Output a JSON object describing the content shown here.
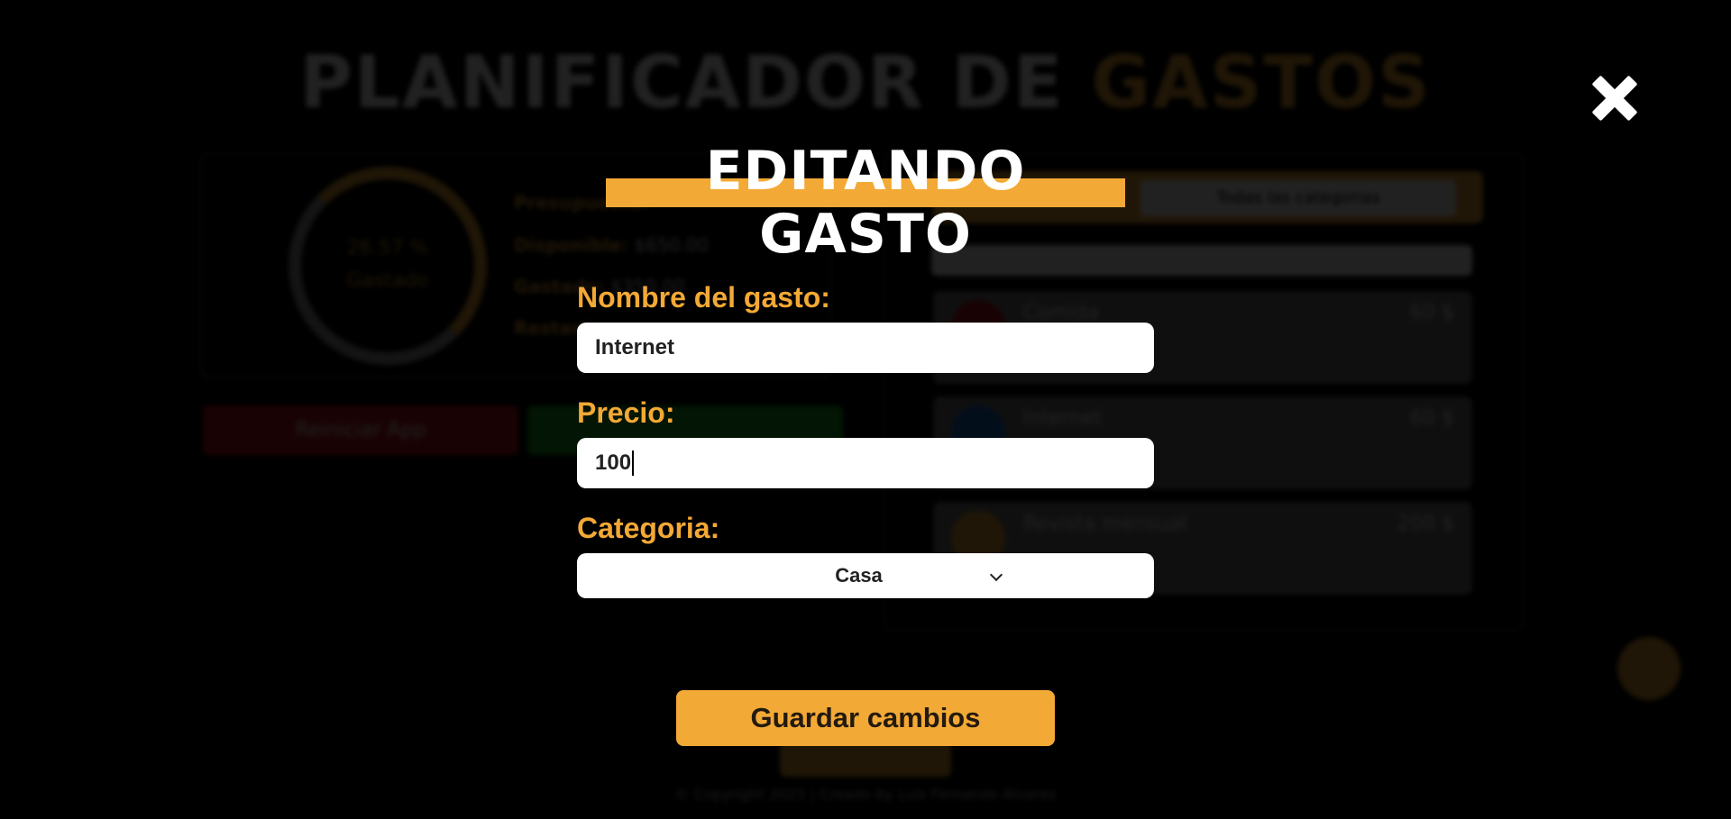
{
  "background": {
    "title_main": "PLANIFICADOR DE",
    "title_accent": "GASTOS",
    "progress_text": "26.57 %",
    "progress_caption": "Gastado",
    "info": [
      {
        "label": "Presupuesto:",
        "value": ""
      },
      {
        "label": "Disponible:",
        "value": "$650.00"
      },
      {
        "label": "Gastado:",
        "value": "$350.00"
      },
      {
        "label": "Restante:",
        "value": ""
      }
    ],
    "reset_button": "Reiniciar App",
    "filter_select": "Todas las categorias",
    "expenses": [
      {
        "name": "Comida",
        "price": "60 $",
        "color": "#c0141b"
      },
      {
        "name": "Internet",
        "price": "60 $",
        "color": "#1b6fd1"
      },
      {
        "name": "Revista mensual",
        "price": "200 $",
        "color": "#f3a935"
      }
    ],
    "footer": "© Copyright 2023 | Creado by Luis Fernando Alvarez"
  },
  "modal": {
    "title": "EDITANDO GASTO",
    "name_label": "Nombre del gasto:",
    "name_value": "Internet",
    "price_label": "Precio:",
    "price_value": "100",
    "category_label": "Categoria:",
    "category_value": "Casa",
    "save_button": "Guardar cambios",
    "close_icon": "close-icon"
  },
  "colors": {
    "accent": "#f3a935",
    "background": "#000000",
    "input_bg": "#ffffff"
  }
}
